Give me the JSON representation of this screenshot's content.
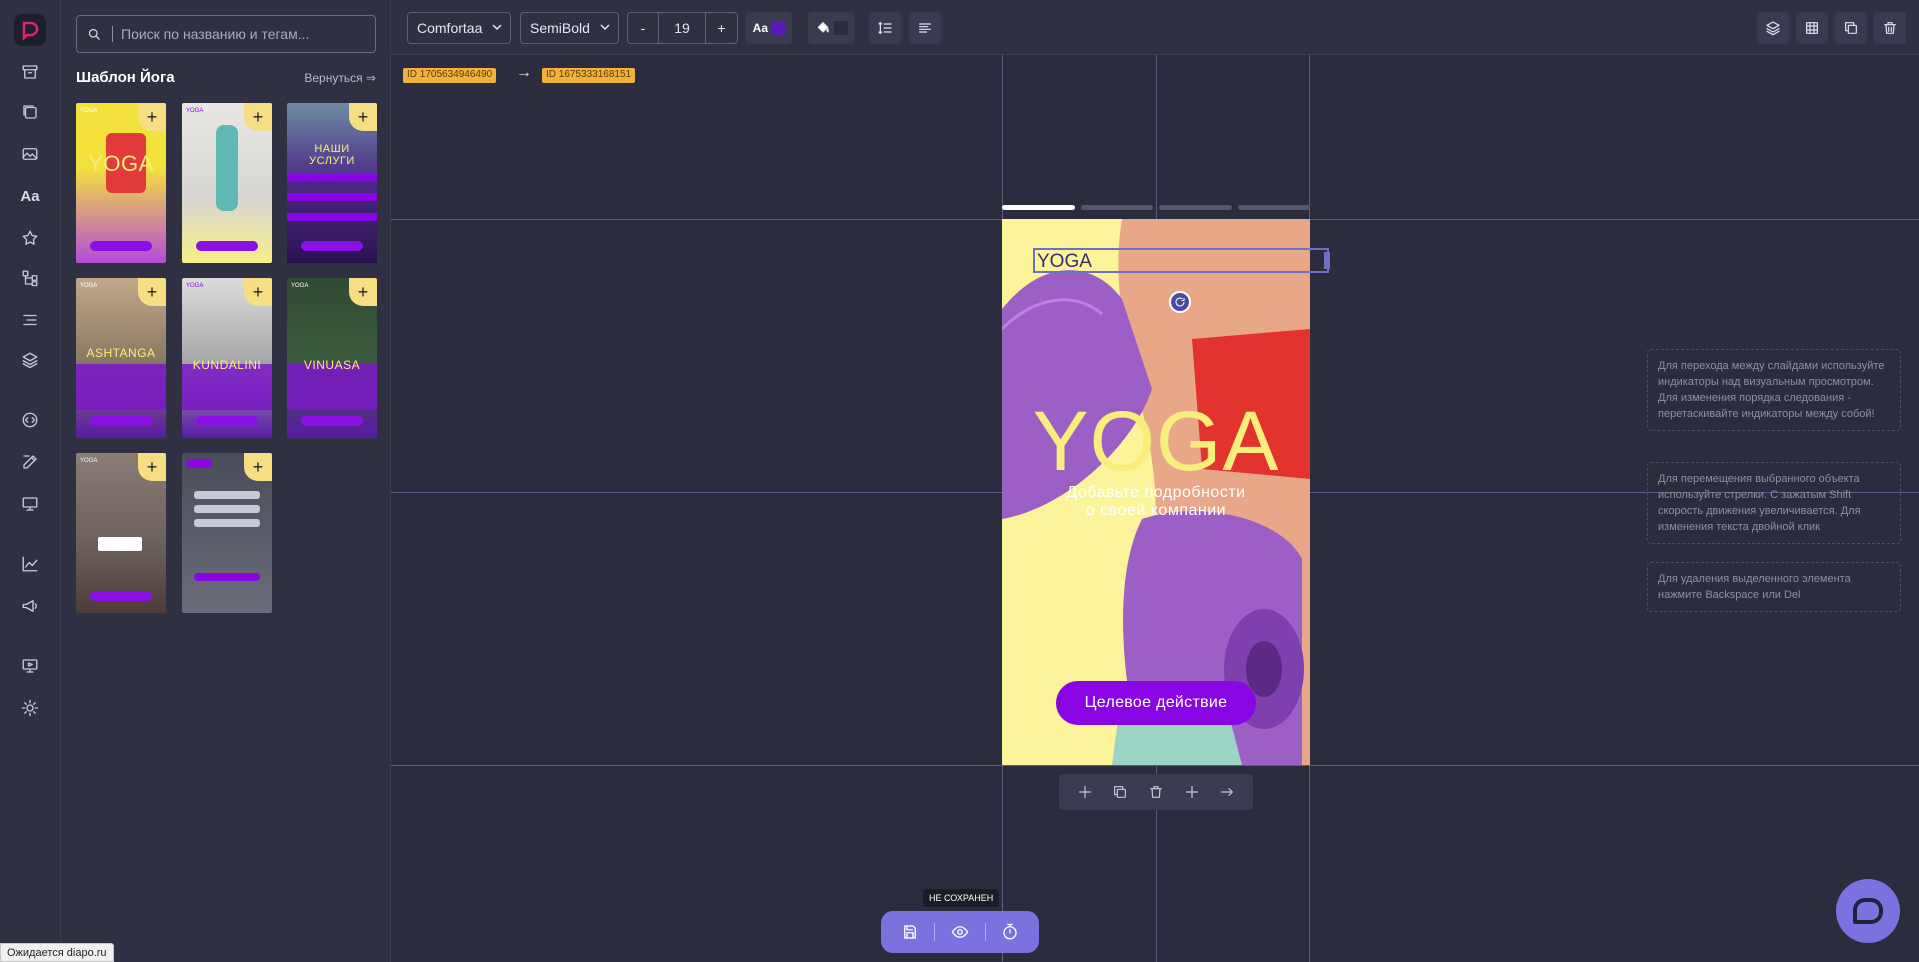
{
  "rail": {
    "icons": [
      "logo-icon",
      "archive-icon",
      "images-icon",
      "gallery-icon",
      "text-icon",
      "star-icon",
      "hierarchy-icon",
      "list-icon",
      "layers-icon",
      "script-icon",
      "edit-icon",
      "monitor-icon",
      "analytics-icon",
      "megaphone-icon",
      "presentation-icon",
      "theme-icon"
    ]
  },
  "panel": {
    "search_placeholder": "Поиск по названию и тегам...",
    "title": "Шаблон Йога",
    "back_label": "Вернуться ⇒",
    "thumbs": [
      {
        "label": "YOGA",
        "bg": "#f4e23c"
      },
      {
        "label": "",
        "bg": "#e8e6e3"
      },
      {
        "label": "НАШИ УСЛУГИ",
        "bg": "#4b2a86"
      },
      {
        "label": "ASHTANGA",
        "bg": "#8c7a63"
      },
      {
        "label": "KUNDALINI",
        "bg": "#cfcfcf"
      },
      {
        "label": "VINUASA",
        "bg": "#3a5a3e"
      },
      {
        "label": "",
        "bg": "#7a6a66"
      },
      {
        "label": "",
        "bg": "#5a5c6a"
      }
    ],
    "thumb_badge": "YOGA",
    "plus_symbol": "+"
  },
  "toolbar": {
    "font_family": "Comfortaa",
    "font_weight": "SemiBold",
    "minus": "-",
    "font_size": "19",
    "plus": "+",
    "text_color": "#5a1ab8",
    "aa_label": "Aa"
  },
  "canvas": {
    "id_from": "ID 1705634946490",
    "id_arrow": "→",
    "id_to": "ID 1675333168151",
    "selected_text": "YOGA",
    "slide": {
      "title": "YOGA",
      "subtitle_line1": "Добавьте подробности",
      "subtitle_line2": "о своей компании",
      "cta": "Целевое действие"
    }
  },
  "hints": [
    "Для перехода между слайдами используйте индикаторы над визуальным просмотром. Для изменения порядка следования - перетаскивайте индикаторы между собой!",
    "Для перемещения выбранного объекта используйте стрелки. С зажатым Shift скорость движения увеличивается. Для изменения текста двойной клик",
    "Для удаления выделенного элемента нажмите Backspace или Del"
  ],
  "savebar": {
    "not_saved": "НЕ СОХРАНЕН"
  },
  "status": "Ожидается diapo.ru",
  "colors": {
    "accent": "#7b72e0",
    "cta": "#8a05e3",
    "badge": "#f2b03c",
    "plus_bg": "#f6df82"
  }
}
